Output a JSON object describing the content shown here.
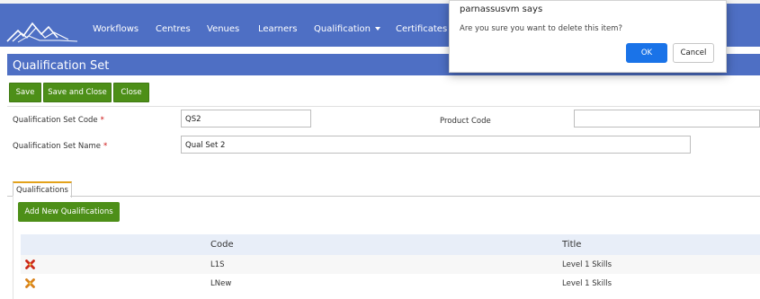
{
  "nav": {
    "items": [
      {
        "label": "Workflows"
      },
      {
        "label": "Centres"
      },
      {
        "label": "Venues"
      },
      {
        "label": "Learners"
      },
      {
        "label": "Qualification"
      },
      {
        "label": "Certificates"
      }
    ],
    "brand_color": "#4e6fc4"
  },
  "page": {
    "title": "Qualification Set"
  },
  "toolbar": {
    "save": "Save",
    "save_close": "Save and Close",
    "close": "Close",
    "button_color": "#4d8f18"
  },
  "form": {
    "code_label": "Qualification Set Code",
    "code_value": "QS2",
    "name_label": "Qualification Set Name",
    "name_value": "Qual Set 2",
    "product_code_label": "Product Code",
    "product_code_value": "",
    "required_marker": "*"
  },
  "tabs": [
    {
      "label": "Qualifications",
      "active": true
    }
  ],
  "qualifications": {
    "add_button": "Add New Qualifications",
    "columns": [
      "Code",
      "Title"
    ],
    "rows": [
      {
        "code": "L1S",
        "title": "Level 1 Skills"
      },
      {
        "code": "LNew",
        "title": "Level 1 Skills"
      }
    ]
  },
  "dialog": {
    "title": "parnassusvm says",
    "message": "Are you sure you want to delete this item?",
    "ok": "OK",
    "cancel": "Cancel",
    "ok_color": "#1a73e8"
  }
}
